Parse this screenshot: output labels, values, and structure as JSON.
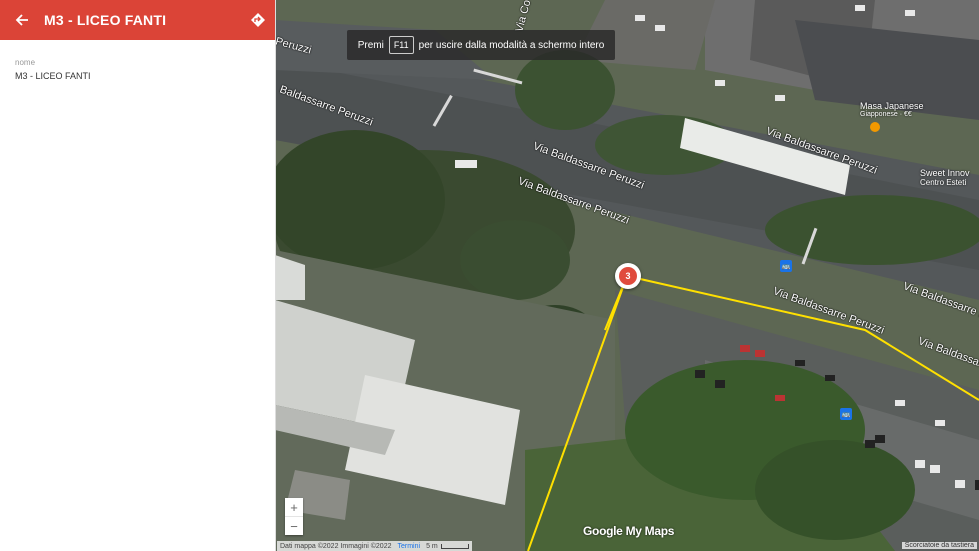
{
  "panel": {
    "title": "M3 - LICEO FANTI",
    "field_label": "nome",
    "field_value": "M3 - LICEO FANTI"
  },
  "banner": {
    "prefix": "Premi",
    "key": "F11",
    "suffix": "per uscire dalla modalità a schermo intero"
  },
  "map": {
    "marker_number": "3",
    "zoom_in": "+",
    "zoom_out": "−",
    "logo": "Google My Maps",
    "attribution": "Dati mappa ©2022 Immagini ©2022",
    "terms": "Termini",
    "scale_label": "5 m",
    "shortcuts": "Scorciatoie da tastiera",
    "street_labels": {
      "a": "Peruzzi",
      "b": "Baldassarre Peruzzi",
      "c": "Via Baldassarre Peruzzi",
      "d": "Via Baldassarre Peruzzi",
      "e": "Via Baldassarre Peruzzi",
      "f": "Via Baldassarre Peruzzi",
      "g": "Via Baldassarre Peruzzi",
      "h": "Via Baldassarre Peruzzi",
      "i": "Via Co"
    },
    "poi": {
      "name1": "Masa Japanese",
      "sub1": "Giapponese · €€",
      "name2": "Sweet Innov",
      "sub2": "Centro Esteti"
    }
  },
  "colors": {
    "header": "#db4437",
    "route": "#ffe000",
    "marker": "#e04b3d"
  }
}
